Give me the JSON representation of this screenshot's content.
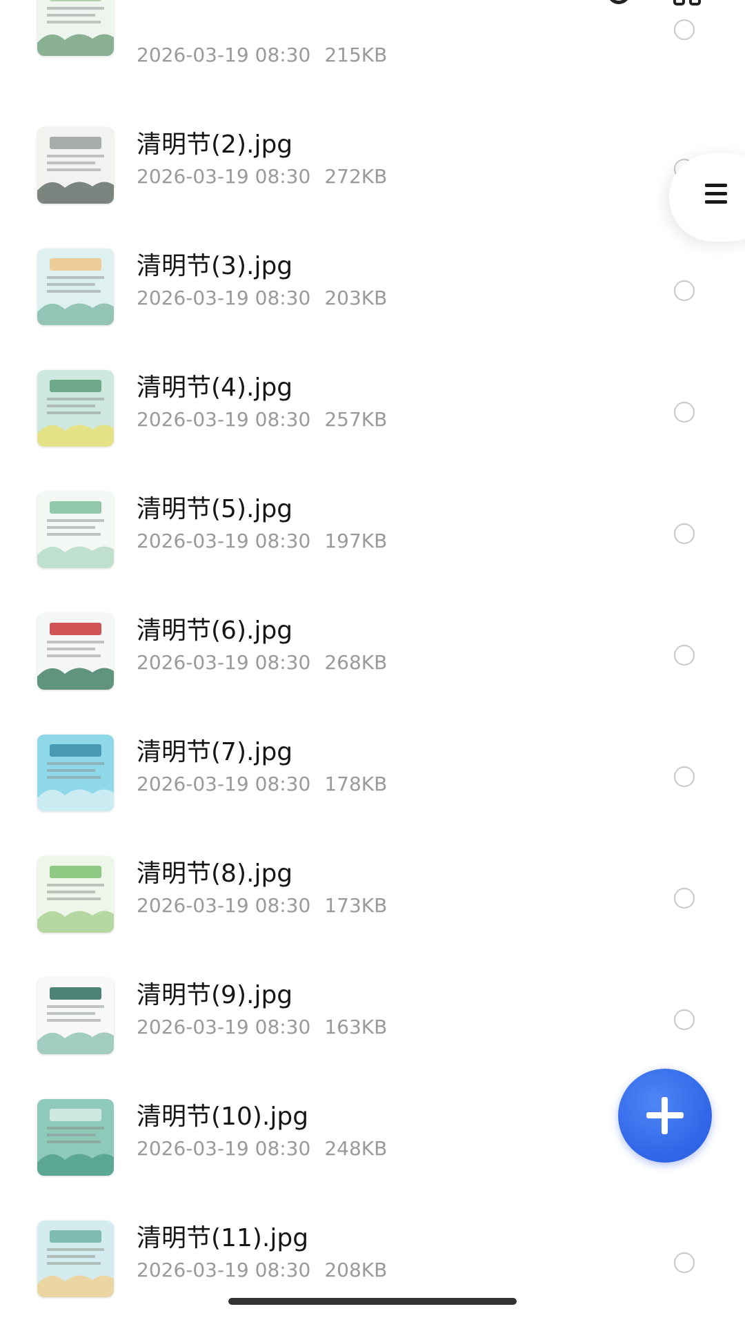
{
  "header": {
    "title": "",
    "search_icon": "search-icon",
    "view_icon": "grid-view-icon"
  },
  "files": [
    {
      "name": "",
      "date": "2026-03-19 08:30",
      "size": "215KB"
    },
    {
      "name": "清明节(2).jpg",
      "date": "2026-03-19 08:30",
      "size": "272KB"
    },
    {
      "name": "清明节(3).jpg",
      "date": "2026-03-19 08:30",
      "size": "203KB"
    },
    {
      "name": "清明节(4).jpg",
      "date": "2026-03-19 08:30",
      "size": "257KB"
    },
    {
      "name": "清明节(5).jpg",
      "date": "2026-03-19 08:30",
      "size": "197KB"
    },
    {
      "name": "清明节(6).jpg",
      "date": "2026-03-19 08:30",
      "size": "268KB"
    },
    {
      "name": "清明节(7).jpg",
      "date": "2026-03-19 08:30",
      "size": "178KB"
    },
    {
      "name": "清明节(8).jpg",
      "date": "2026-03-19 08:30",
      "size": "173KB"
    },
    {
      "name": "清明节(9).jpg",
      "date": "2026-03-19 08:30",
      "size": "163KB"
    },
    {
      "name": "清明节(10).jpg",
      "date": "2026-03-19 08:30",
      "size": "248KB"
    },
    {
      "name": "清明节(11).jpg",
      "date": "2026-03-19 08:30",
      "size": "208KB"
    }
  ],
  "side_handle": {
    "icon": "menu-icon"
  },
  "fab": {
    "icon": "plus-icon"
  },
  "colors": {
    "accent": "#2f65e6",
    "text_primary": "#161616",
    "text_secondary": "#9a9a9a",
    "radio_border": "#c8c8c8"
  }
}
